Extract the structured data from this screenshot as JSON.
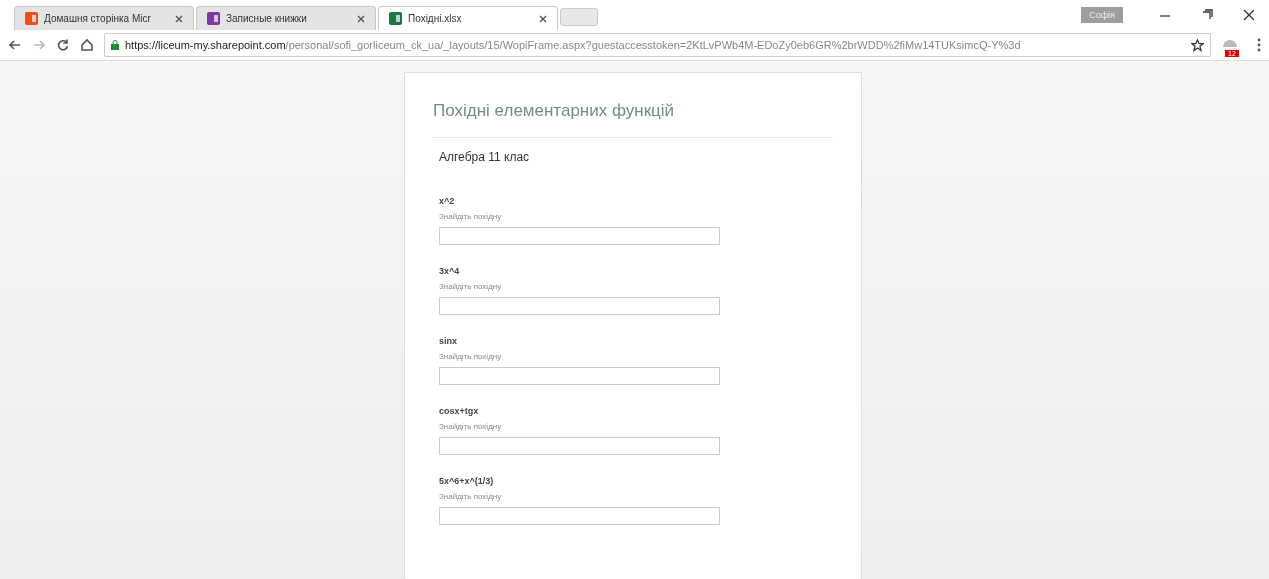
{
  "tabs": [
    {
      "label": "Домашня сторінка Micr",
      "selected": false,
      "kind": "office"
    },
    {
      "label": "Записные книжки",
      "selected": false,
      "kind": "onenote"
    },
    {
      "label": "Похідні.xlsx",
      "selected": true,
      "kind": "excel"
    }
  ],
  "profile": "Софія",
  "address": {
    "domain": "https://liceum-my.sharepoint.com",
    "path": "/personal/sofi_gorliceum_ck_ua/_layouts/15/WopiFrame.aspx?guestaccesstoken=2KtLvPWb4M-EDoZy0eb6GR%2brWDD%2fiMw14TUKsimcQ-Y%3d"
  },
  "extension_badge": "12",
  "form": {
    "title": "Похідні елементарних функцій",
    "subtitle": "Алгебра 11 клас",
    "questions": [
      {
        "label": "x^2",
        "hint": "Знайдіть похідну"
      },
      {
        "label": "3x^4",
        "hint": "Знайдіть похідну"
      },
      {
        "label": "sinx",
        "hint": "Знайдіть похідну"
      },
      {
        "label": "cosx+tgx",
        "hint": "Знайдіть похідну"
      },
      {
        "label": "5x^6+x^(1/3)",
        "hint": "Знайдіть похідну"
      }
    ]
  }
}
